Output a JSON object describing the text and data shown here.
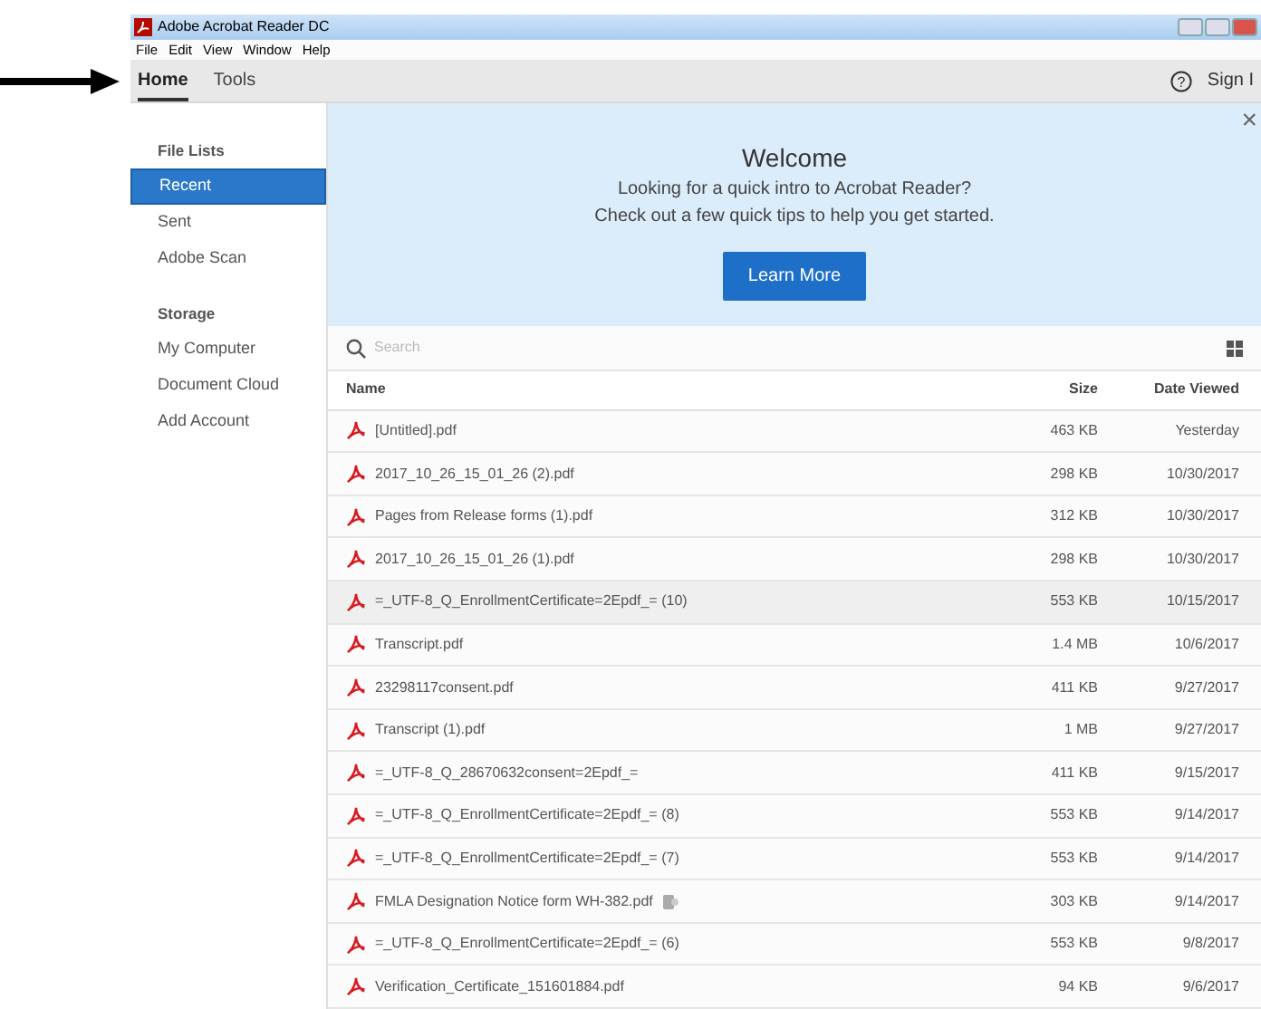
{
  "window": {
    "title": "Adobe Acrobat Reader DC"
  },
  "menu": [
    "File",
    "Edit",
    "View",
    "Window",
    "Help"
  ],
  "tabs": [
    {
      "label": "Home",
      "selected": true
    },
    {
      "label": "Tools",
      "selected": false
    }
  ],
  "help": "?",
  "sign_in": "Sign I",
  "sidebar": [
    {
      "heading": "File Lists",
      "items": [
        {
          "label": "Recent",
          "selected": true
        },
        {
          "label": "Sent",
          "selected": false
        },
        {
          "label": "Adobe Scan",
          "selected": false
        }
      ]
    },
    {
      "heading": "Storage",
      "items": [
        {
          "label": "My Computer",
          "selected": false
        },
        {
          "label": "Document Cloud",
          "selected": false
        },
        {
          "label": "Add Account",
          "selected": false
        }
      ]
    }
  ],
  "welcome": {
    "title": "Welcome",
    "lines": [
      "Looking for a quick intro to Acrobat Reader?",
      "Check out a few quick tips to help you get started."
    ],
    "button": "Learn More",
    "close": "×"
  },
  "search": {
    "placeholder": "Search"
  },
  "table": {
    "columns": [
      "Name",
      "Size",
      "Date Viewed"
    ],
    "rows": [
      {
        "name": "[Untitled].pdf",
        "size": "463 KB",
        "date": "Yesterday",
        "highlighted": false,
        "shared": false
      },
      {
        "name": "2017_10_26_15_01_26 (2).pdf",
        "size": "298 KB",
        "date": "10/30/2017",
        "highlighted": false,
        "shared": false
      },
      {
        "name": "Pages from Release forms (1).pdf",
        "size": "312 KB",
        "date": "10/30/2017",
        "highlighted": false,
        "shared": false
      },
      {
        "name": "2017_10_26_15_01_26 (1).pdf",
        "size": "298 KB",
        "date": "10/30/2017",
        "highlighted": false,
        "shared": false
      },
      {
        "name": "=_UTF-8_Q_EnrollmentCertificate=2Epdf_= (10)",
        "size": "553 KB",
        "date": "10/15/2017",
        "highlighted": true,
        "shared": false
      },
      {
        "name": "Transcript.pdf",
        "size": "1.4 MB",
        "date": "10/6/2017",
        "highlighted": false,
        "shared": false
      },
      {
        "name": "23298117consent.pdf",
        "size": "411 KB",
        "date": "9/27/2017",
        "highlighted": false,
        "shared": false
      },
      {
        "name": "Transcript (1).pdf",
        "size": "1 MB",
        "date": "9/27/2017",
        "highlighted": false,
        "shared": false
      },
      {
        "name": "=_UTF-8_Q_28670632consent=2Epdf_=",
        "size": "411 KB",
        "date": "9/15/2017",
        "highlighted": false,
        "shared": false
      },
      {
        "name": "=_UTF-8_Q_EnrollmentCertificate=2Epdf_= (8)",
        "size": "553 KB",
        "date": "9/14/2017",
        "highlighted": false,
        "shared": false
      },
      {
        "name": "=_UTF-8_Q_EnrollmentCertificate=2Epdf_= (7)",
        "size": "553 KB",
        "date": "9/14/2017",
        "highlighted": false,
        "shared": false
      },
      {
        "name": "FMLA Designation Notice form WH-382.pdf",
        "size": "303 KB",
        "date": "9/14/2017",
        "highlighted": false,
        "shared": true
      },
      {
        "name": "=_UTF-8_Q_EnrollmentCertificate=2Epdf_= (6)",
        "size": "553 KB",
        "date": "9/8/2017",
        "highlighted": false,
        "shared": false
      },
      {
        "name": "Verification_Certificate_151601884.pdf",
        "size": "94 KB",
        "date": "9/6/2017",
        "highlighted": false,
        "shared": false
      }
    ]
  }
}
